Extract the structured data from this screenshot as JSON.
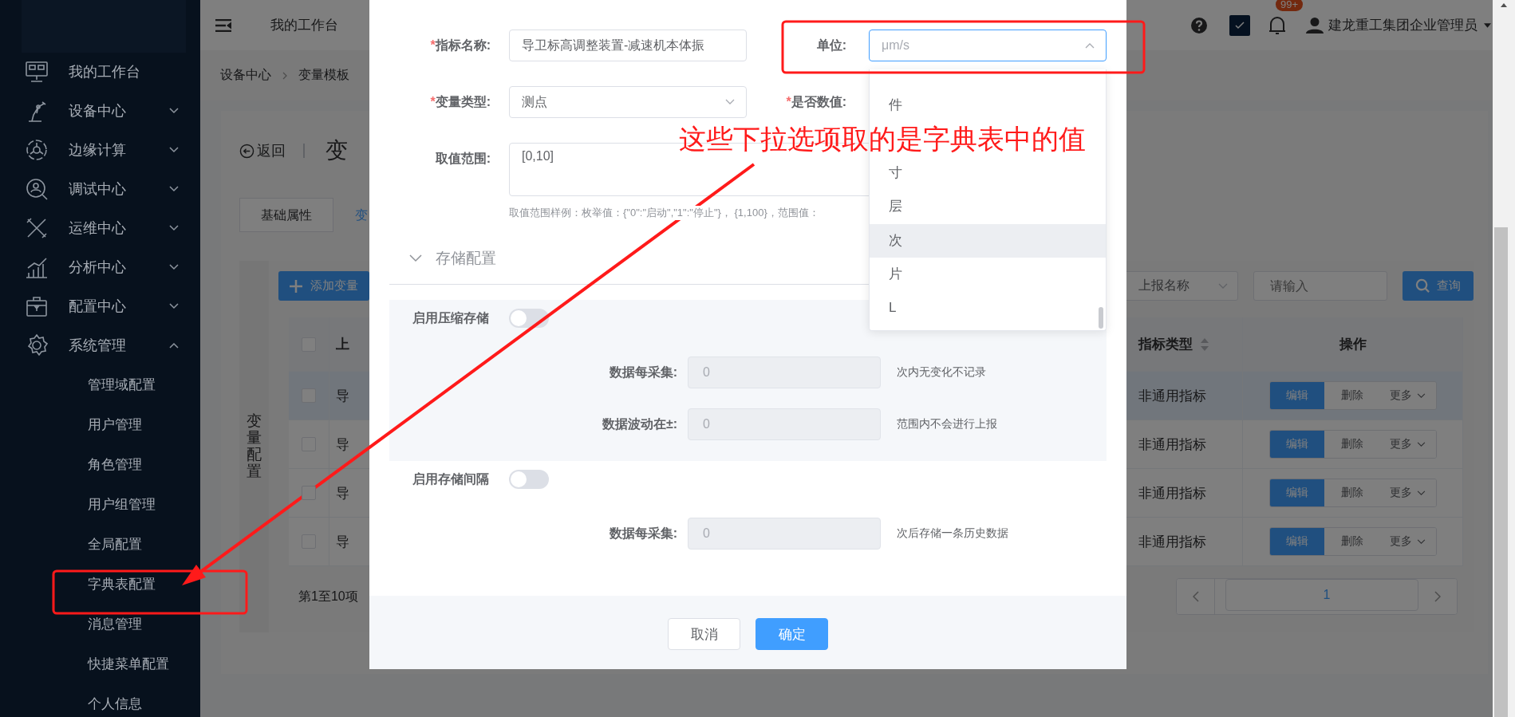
{
  "sidebar": {
    "home": {
      "label": "我的工作台"
    },
    "groups": [
      {
        "label": "设备中心",
        "expanded": false
      },
      {
        "label": "边缘计算",
        "expanded": false
      },
      {
        "label": "调试中心",
        "expanded": false
      },
      {
        "label": "运维中心",
        "expanded": false
      },
      {
        "label": "分析中心",
        "expanded": false
      },
      {
        "label": "配置中心",
        "expanded": false
      },
      {
        "label": "系统管理",
        "expanded": true,
        "children": [
          {
            "label": "管理域配置"
          },
          {
            "label": "用户管理"
          },
          {
            "label": "角色管理"
          },
          {
            "label": "用户组管理"
          },
          {
            "label": "全局配置"
          },
          {
            "label": "字典表配置"
          },
          {
            "label": "消息管理"
          },
          {
            "label": "快捷菜单配置"
          },
          {
            "label": "个人信息"
          }
        ]
      }
    ]
  },
  "header": {
    "title": "我的工作台",
    "badge": "99+",
    "user": "建龙重工集团企业管理员"
  },
  "breadcrumb": [
    "设备中心",
    "变量模板"
  ],
  "page": {
    "back": "返回",
    "title": "变",
    "tabs": [
      {
        "label": "基础属性",
        "selected": false
      },
      {
        "label": "变",
        "selected": true
      }
    ],
    "side_tab": "变量配置",
    "add_button": "添加变量",
    "filter": {
      "field": "上报名称",
      "search": {
        "placeholder": "请输入"
      },
      "button": "查询"
    },
    "table": {
      "all_checked": false,
      "columns": [
        {
          "label": "上",
          "kind": "plain"
        },
        {
          "label": "指标类型",
          "kind": "sortable"
        },
        {
          "label": "操作",
          "kind": "plain"
        }
      ],
      "rows": [
        {
          "selected": true,
          "checked": false,
          "cells": [
            "导",
            "非通用指标"
          ],
          "actions": [
            {
              "label": "编辑",
              "kind": "primary"
            },
            {
              "label": "删除",
              "kind": "plain"
            },
            {
              "label": "更多",
              "kind": "menu"
            }
          ]
        },
        {
          "selected": false,
          "checked": false,
          "cells": [
            "导",
            "非通用指标"
          ],
          "actions": [
            {
              "label": "编辑",
              "kind": "primary"
            },
            {
              "label": "删除",
              "kind": "plain"
            },
            {
              "label": "更多",
              "kind": "menu"
            }
          ]
        },
        {
          "selected": false,
          "checked": false,
          "cells": [
            "导",
            "非通用指标"
          ],
          "actions": [
            {
              "label": "编辑",
              "kind": "primary"
            },
            {
              "label": "删除",
              "kind": "plain"
            },
            {
              "label": "更多",
              "kind": "menu"
            }
          ]
        },
        {
          "selected": false,
          "checked": false,
          "cells": [
            "导",
            "非通用指标"
          ],
          "actions": [
            {
              "label": "编辑",
              "kind": "primary"
            },
            {
              "label": "删除",
              "kind": "plain"
            },
            {
              "label": "更多",
              "kind": "menu"
            }
          ]
        }
      ]
    },
    "summary": "第1至10项",
    "pagination": {
      "pages": [
        {
          "label": "1",
          "selected": true
        }
      ]
    }
  },
  "dialog": {
    "rows": [
      [
        {
          "required_mark": "*",
          "label": "指标名称:",
          "kind": "input",
          "value": "导卫标高调整装置-减速机本体振"
        },
        {
          "label": "单位:",
          "kind": "select",
          "placeholder": "μm/s",
          "focused": true,
          "expanded": true
        }
      ],
      [
        {
          "required_mark": "*",
          "label": "变量类型:",
          "kind": "select",
          "value": "测点",
          "focused": false,
          "expanded": false
        },
        {
          "required_mark": "*",
          "label": "是否数值:"
        }
      ],
      [
        {
          "label": "取值范围:",
          "kind": "textarea",
          "value": "[0,10]",
          "hint": "取值范围样例：枚举值：{\"0\":\"启动\",\"1\":\"停止\"}， {1,100}，范围值："
        }
      ]
    ],
    "section": {
      "title": "存储配置",
      "expanded": true
    },
    "groups": [
      {
        "label": "启用压缩存储",
        "kind": "panel",
        "on": false,
        "rows": [
          {
            "label": "数据每采集:",
            "placeholder": "0",
            "disabled": true,
            "suffix": "次内无变化不记录"
          },
          {
            "label": "数据波动在±:",
            "placeholder": "0",
            "disabled": true,
            "suffix": "范围内不会进行上报"
          }
        ]
      },
      {
        "label": "启用存储间隔",
        "kind": "plain",
        "on": false,
        "rows": [
          {
            "label": "数据每采集:",
            "placeholder": "0",
            "disabled": true,
            "suffix": "次后存储一条历史数据"
          }
        ]
      }
    ],
    "buttons": [
      {
        "label": "取消",
        "kind": "default"
      },
      {
        "label": "确定",
        "kind": "primary"
      }
    ]
  },
  "dropdown": {
    "options": [
      {
        "label": "件",
        "hovered": false
      },
      {
        "hovered": false
      },
      {
        "label": "寸",
        "hovered": false
      },
      {
        "label": "层",
        "hovered": false
      },
      {
        "label": "次",
        "hovered": true
      },
      {
        "label": "片",
        "hovered": false
      },
      {
        "label": "L",
        "hovered": false
      }
    ]
  },
  "annotation": {
    "text": "这些下拉选项取的是字典表中的值"
  }
}
